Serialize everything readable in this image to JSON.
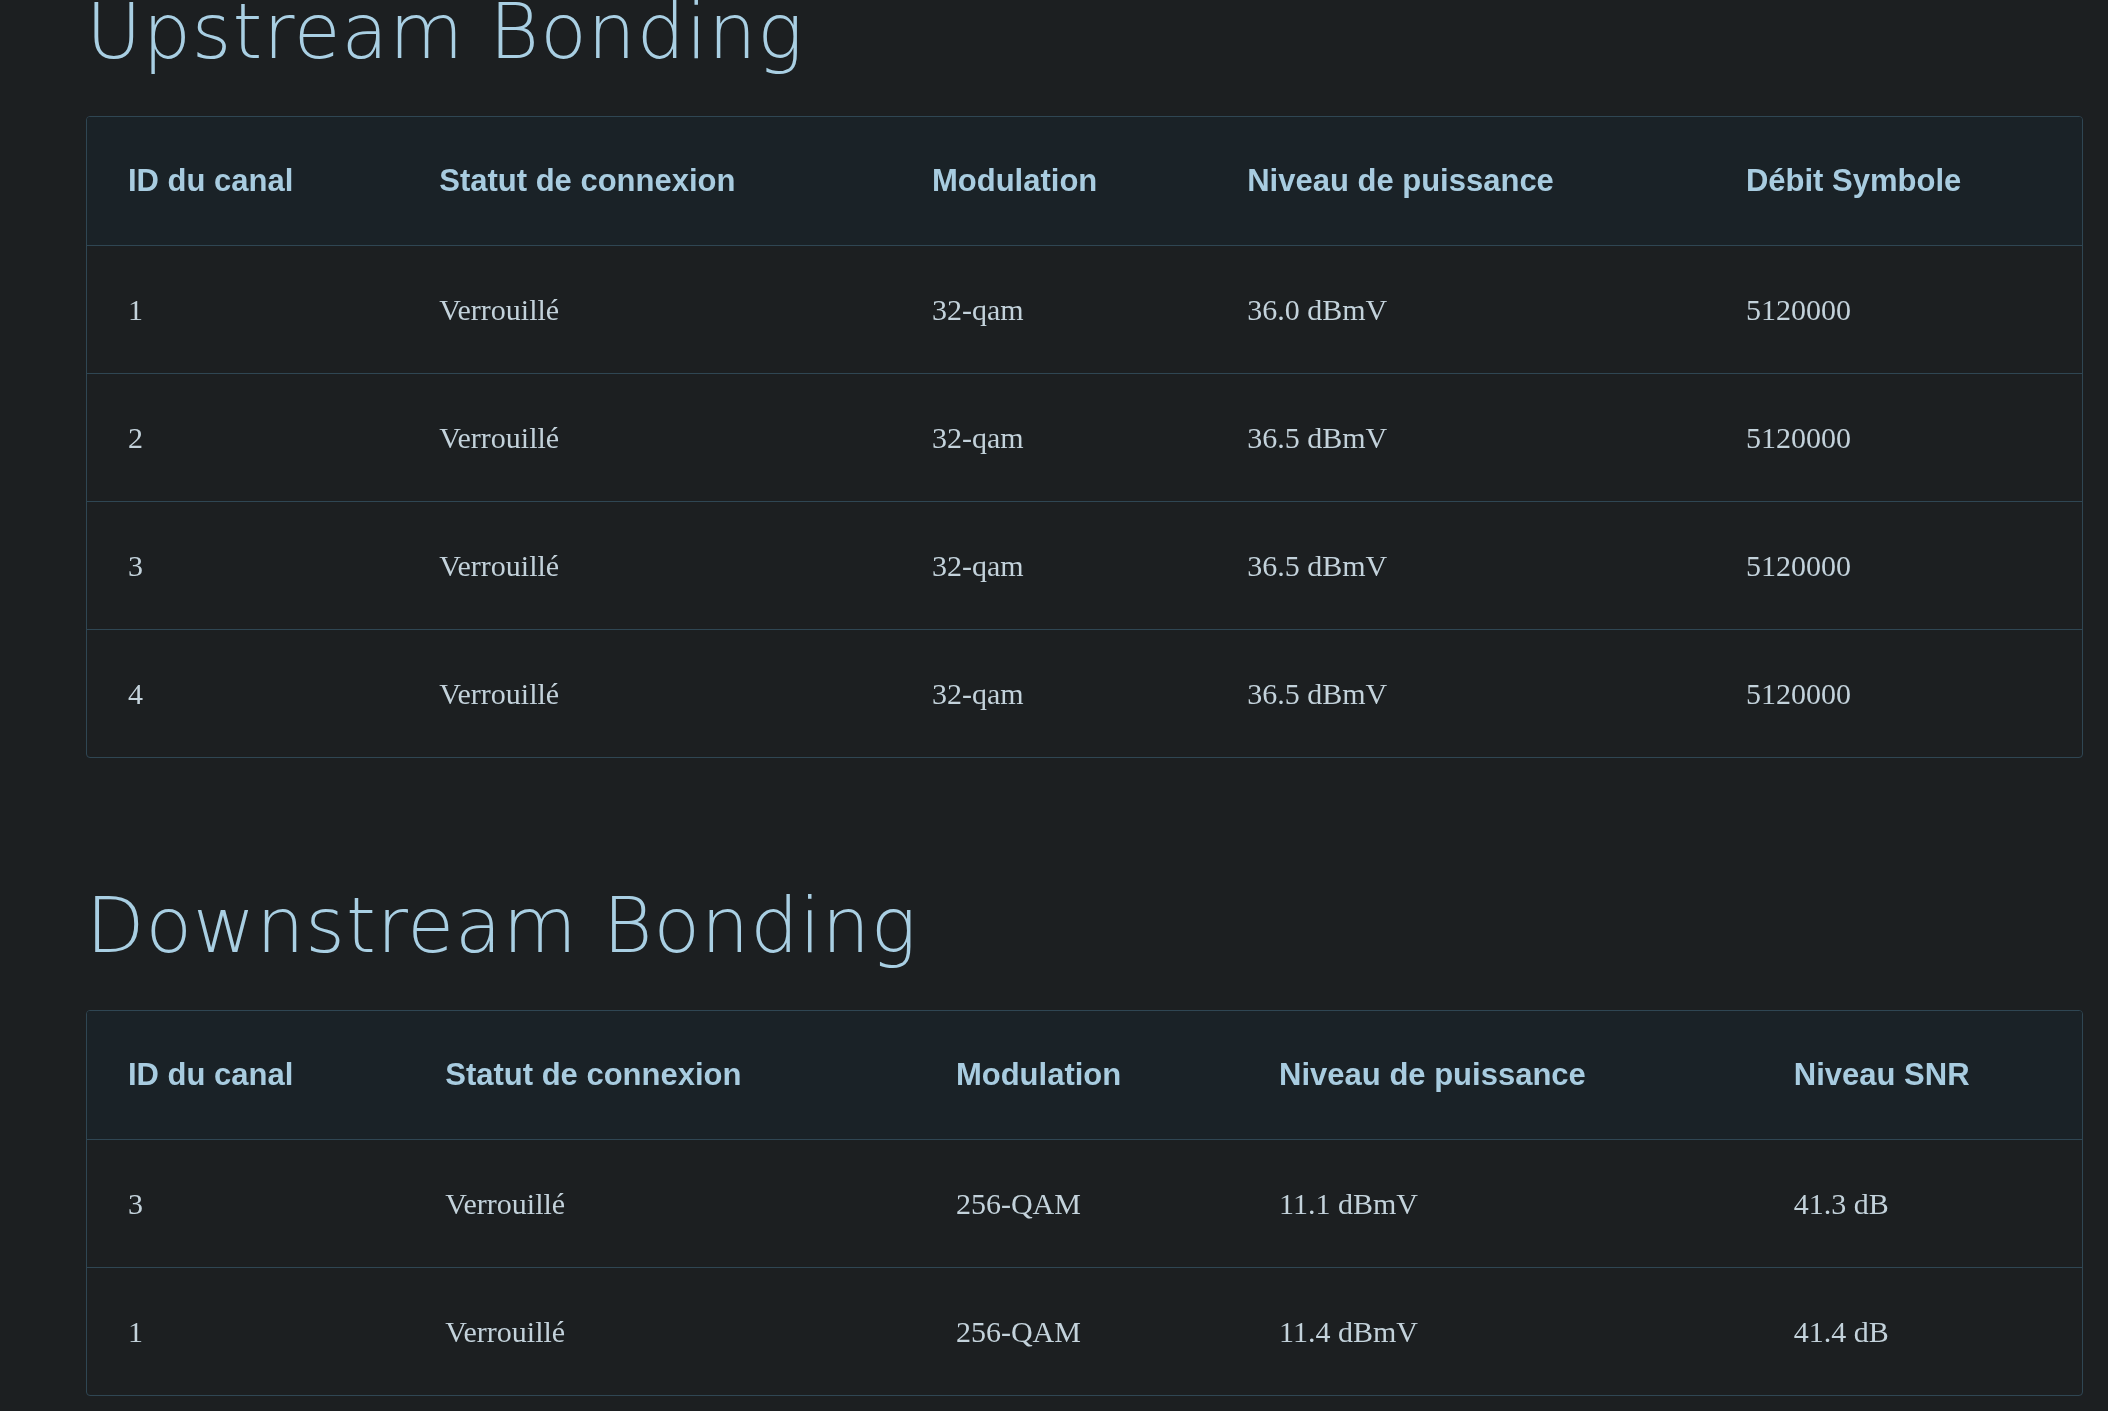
{
  "sections": [
    {
      "title": "Upstream Bonding",
      "table": {
        "columns": [
          "ID du canal",
          "Statut de connexion",
          "Modulation",
          "Niveau de puissance",
          "Débit Symbole"
        ],
        "rows": [
          [
            "1",
            "Verrouillé",
            "32-qam",
            "36.0 dBmV",
            "5120000"
          ],
          [
            "2",
            "Verrouillé",
            "32-qam",
            "36.5 dBmV",
            "5120000"
          ],
          [
            "3",
            "Verrouillé",
            "32-qam",
            "36.5 dBmV",
            "5120000"
          ],
          [
            "4",
            "Verrouillé",
            "32-qam",
            "36.5 dBmV",
            "5120000"
          ]
        ]
      }
    },
    {
      "title": "Downstream Bonding",
      "table": {
        "columns": [
          "ID du canal",
          "Statut de connexion",
          "Modulation",
          "Niveau de puissance",
          "Niveau SNR"
        ],
        "rows": [
          [
            "3",
            "Verrouillé",
            "256-QAM",
            "11.1 dBmV",
            "41.3 dB"
          ],
          [
            "1",
            "Verrouillé",
            "256-QAM",
            "11.4 dBmV",
            "41.4 dB"
          ]
        ]
      }
    }
  ]
}
